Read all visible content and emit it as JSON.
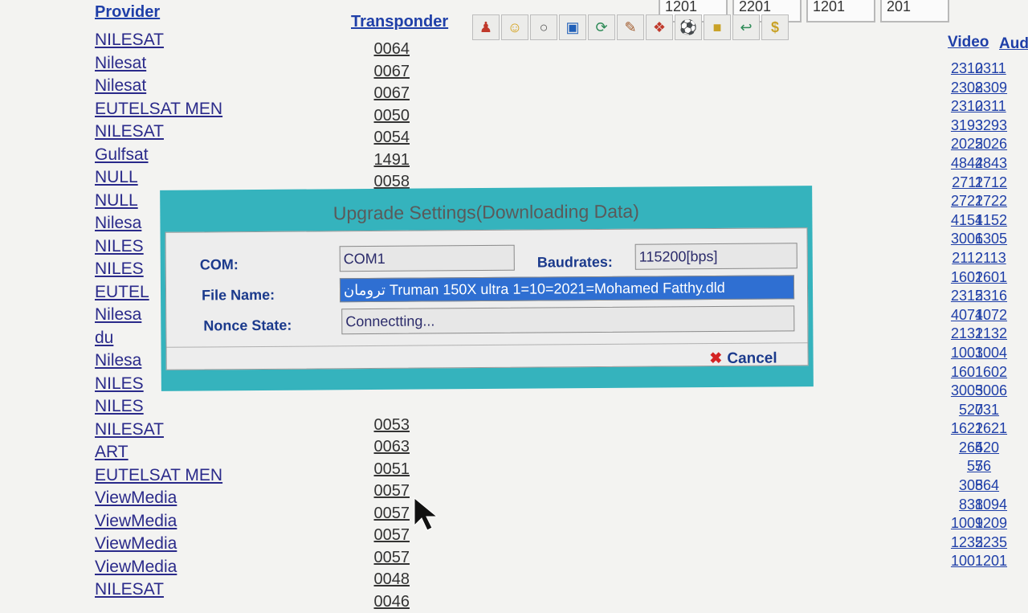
{
  "header": {
    "provider_label": "Provider",
    "transponder_label": "Transponder",
    "video_label": "Video",
    "audio_label": "Aud",
    "top_cells": [
      "1201",
      "2201",
      "1201",
      "201"
    ]
  },
  "toolbar_icons": [
    "people-icon",
    "face-icon",
    "disc-icon",
    "film-icon",
    "refresh-icon",
    "edit-icon",
    "gift-icon",
    "ball-icon",
    "lock-icon",
    "back-icon",
    "dollar-icon"
  ],
  "providers": [
    "NILESAT",
    "Nilesat",
    "Nilesat",
    "EUTELSAT MEN",
    "NILESAT",
    "Gulfsat",
    "NULL",
    "NULL",
    "Nilesa",
    "NILES",
    "NILES",
    "EUTEL",
    "Nilesa",
    "du",
    "Nilesa",
    "NILES",
    "NILES",
    "NILESAT",
    "ART",
    "EUTELSAT MEN",
    "ViewMedia",
    "ViewMedia",
    "ViewMedia",
    "ViewMedia",
    "NILESAT"
  ],
  "transponders": [
    "0064",
    "0067",
    "0067",
    "0050",
    "0054",
    "1491",
    "0058",
    "",
    "",
    "",
    "",
    "",
    "",
    "",
    "",
    "",
    "",
    "0053",
    "0063",
    "0051",
    "0057",
    "0057",
    "0057",
    "0057",
    "0048",
    "0046"
  ],
  "video": [
    "2310",
    "2308",
    "2310",
    "3193",
    "2025",
    "4842",
    "2711",
    "2721",
    "4151",
    "3006",
    "2112",
    "1601",
    "2315",
    "4071",
    "2131",
    "1003",
    "1601",
    "3005",
    "520",
    "1621",
    "264",
    "57",
    "308",
    "838",
    "1009",
    "1235",
    "1001"
  ],
  "audio": [
    "2311",
    "2309",
    "2311",
    "3293",
    "2026",
    "4843",
    "2712",
    "2722",
    "4152",
    "1305",
    "2113",
    "2601",
    "2316",
    "4072",
    "2132",
    "1004",
    "1602",
    "3006",
    "731",
    "2621",
    "520",
    "56",
    "564",
    "1094",
    "1209",
    "2235",
    "1201"
  ],
  "dialog": {
    "title": "Upgrade Settings(Downloading Data)",
    "com_label": "COM:",
    "com_value": "COM1",
    "baud_label": "Baudrates:",
    "baud_value": "115200[bps]",
    "file_label": "File Name:",
    "file_value": "ترومان Truman 150X ultra 1=10=2021=Mohamed Fatthy.dld",
    "nonce_label": "Nonce State:",
    "nonce_value": "Connectting...",
    "cancel_label": "Cancel"
  }
}
